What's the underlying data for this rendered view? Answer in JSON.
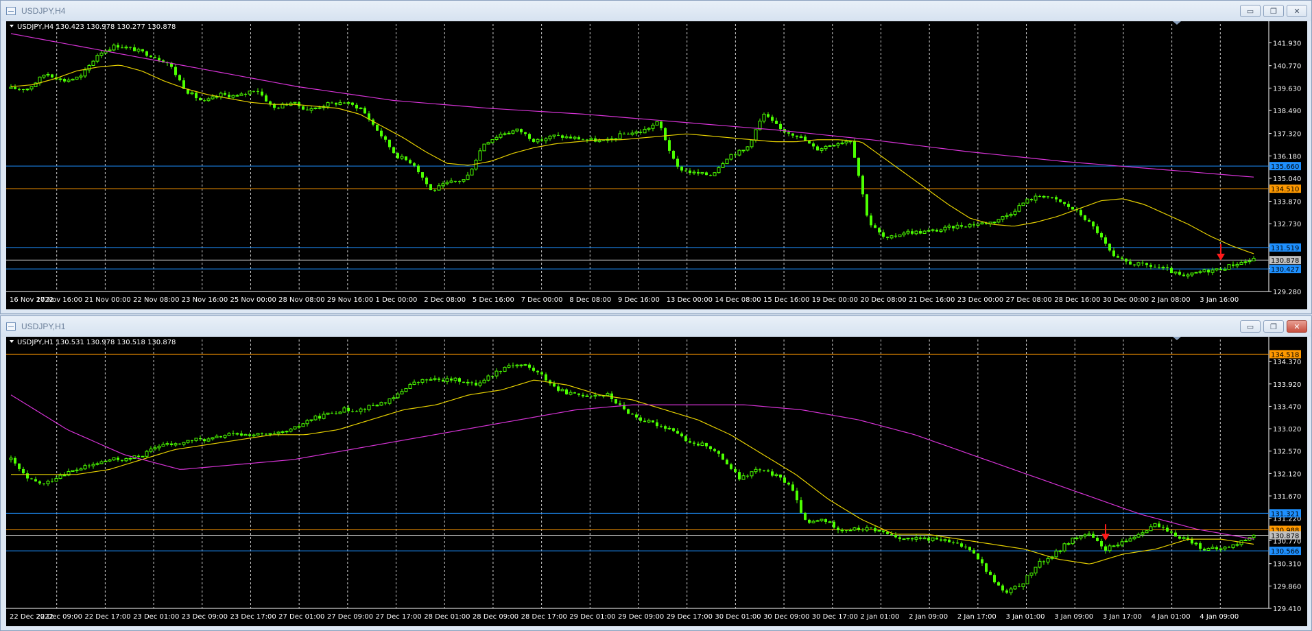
{
  "windows": [
    {
      "title": "USDJPY,H4",
      "info": "USDJPY,H4  130.423 130.978 130.277 130.878",
      "controls": {
        "minimize": "▭",
        "maximize": "❐",
        "close": "✕"
      },
      "chart_data": {
        "type": "candlestick",
        "symbol": "USDJPY",
        "timeframe": "H4",
        "ohlc_last": {
          "open": 130.423,
          "high": 130.978,
          "low": 130.277,
          "close": 130.878
        },
        "ylim": [
          129.28,
          142.4
        ],
        "y_ticks": [
          141.93,
          140.77,
          139.63,
          138.49,
          137.32,
          136.18,
          135.04,
          133.87,
          132.73,
          131.59,
          130.45,
          129.28
        ],
        "y_tick_labels": [
          "141.930",
          "140.770",
          "139.630",
          "138.490",
          "137.320",
          "136.180",
          "135.040",
          "133.870",
          "132.730",
          "131.590",
          "130.450",
          "129.280"
        ],
        "x_labels": [
          "16 Nov 2022",
          "17 Nov 16:00",
          "21 Nov 00:00",
          "22 Nov 08:00",
          "23 Nov 16:00",
          "25 Nov 00:00",
          "28 Nov 08:00",
          "29 Nov 16:00",
          "1 Dec 00:00",
          "2 Dec 08:00",
          "5 Dec 16:00",
          "7 Dec 00:00",
          "8 Dec 08:00",
          "9 Dec 16:00",
          "13 Dec 00:00",
          "14 Dec 08:00",
          "15 Dec 16:00",
          "19 Dec 00:00",
          "20 Dec 08:00",
          "21 Dec 16:00",
          "23 Dec 00:00",
          "27 Dec 08:00",
          "28 Dec 16:00",
          "30 Dec 00:00",
          "2 Jan 08:00",
          "3 Jan 16:00"
        ],
        "grid": true,
        "hlines": [
          {
            "price": 135.66,
            "label": "135.660",
            "color": "#1e90ff"
          },
          {
            "price": 134.51,
            "label": "134.510",
            "color": "#ff9900"
          },
          {
            "price": 131.519,
            "label": "131.519",
            "color": "#1e90ff"
          },
          {
            "price": 130.878,
            "label": "130.878",
            "color": "#c0c0c0"
          },
          {
            "price": 130.427,
            "label": "130.427",
            "color": "#1e90ff"
          }
        ],
        "ma_fast_color": "#e6d000",
        "ma_slow_color": "#d633d6",
        "candle_color": "#4cff00",
        "arrow_color": "#ff1a1a",
        "close_path": [
          139.6,
          139.6,
          140.4,
          140.0,
          140.2,
          141.4,
          141.8,
          141.6,
          141.3,
          140.9,
          139.5,
          138.9,
          139.3,
          139.2,
          139.6,
          138.6,
          138.9,
          138.5,
          138.8,
          138.9,
          138.6,
          137.4,
          136.2,
          135.8,
          134.4,
          134.8,
          135.0,
          136.8,
          137.3,
          137.5,
          136.9,
          137.2,
          137.1,
          137.0,
          136.9,
          137.3,
          137.4,
          137.9,
          135.6,
          135.3,
          135.2,
          136.2,
          136.5,
          138.3,
          137.5,
          137.2,
          136.5,
          136.8,
          137.0,
          132.8,
          131.9,
          132.3,
          132.3,
          132.4,
          132.6,
          132.7,
          132.8,
          133.2,
          133.9,
          134.2,
          133.8,
          133.3,
          132.4,
          131.0,
          130.7,
          130.6,
          130.4,
          130.0,
          130.3,
          130.4,
          130.7,
          130.9
        ],
        "ma_fast_path": [
          139.7,
          139.8,
          140.1,
          140.5,
          140.7,
          140.8,
          140.5,
          140.0,
          139.6,
          139.3,
          139.1,
          138.9,
          138.8,
          138.8,
          138.7,
          138.6,
          138.3,
          137.7,
          137.1,
          136.4,
          135.8,
          135.7,
          135.9,
          136.3,
          136.6,
          136.8,
          136.9,
          137.0,
          137.0,
          137.1,
          137.2,
          137.3,
          137.2,
          137.1,
          137.0,
          136.9,
          136.9,
          137.0,
          137.0,
          136.9,
          136.1,
          135.3,
          134.5,
          133.7,
          133.0,
          132.7,
          132.6,
          132.8,
          133.1,
          133.5,
          133.9,
          134.0,
          133.7,
          133.2,
          132.7,
          132.1,
          131.6,
          131.2
        ],
        "ma_slow_path": [
          142.4,
          141.5,
          140.6,
          139.7,
          139.0,
          138.6,
          138.3,
          137.9,
          137.5,
          137.0,
          136.4,
          135.9,
          135.5,
          135.1
        ],
        "arrow_index": 70
      }
    },
    {
      "title": "USDJPY,H1",
      "info": "USDJPY,H1  130.531 130.978 130.518 130.878",
      "controls": {
        "minimize": "▭",
        "maximize": "❐",
        "close": "✕"
      },
      "chart_data": {
        "type": "candlestick",
        "symbol": "USDJPY",
        "timeframe": "H1",
        "ohlc_last": {
          "open": 130.531,
          "high": 130.978,
          "low": 130.518,
          "close": 130.878
        },
        "ylim": [
          129.41,
          134.62
        ],
        "y_ticks": [
          134.37,
          133.92,
          133.47,
          133.02,
          132.57,
          132.12,
          131.67,
          131.22,
          130.77,
          130.31,
          129.86,
          129.41
        ],
        "y_tick_labels": [
          "134.370",
          "133.920",
          "133.470",
          "133.020",
          "132.570",
          "132.120",
          "131.670",
          "131.220",
          "130.770",
          "130.310",
          "129.860",
          "129.410"
        ],
        "x_labels": [
          "22 Dec 2022",
          "22 Dec 09:00",
          "22 Dec 17:00",
          "23 Dec 01:00",
          "23 Dec 09:00",
          "23 Dec 17:00",
          "27 Dec 01:00",
          "27 Dec 09:00",
          "27 Dec 17:00",
          "28 Dec 01:00",
          "28 Dec 09:00",
          "28 Dec 17:00",
          "29 Dec 01:00",
          "29 Dec 09:00",
          "29 Dec 17:00",
          "30 Dec 01:00",
          "30 Dec 09:00",
          "30 Dec 17:00",
          "2 Jan 01:00",
          "2 Jan 09:00",
          "2 Jan 17:00",
          "3 Jan 01:00",
          "3 Jan 09:00",
          "3 Jan 17:00",
          "4 Jan 01:00",
          "4 Jan 09:00"
        ],
        "grid": true,
        "hlines": [
          {
            "price": 134.518,
            "label": "134.518",
            "color": "#ff9900"
          },
          {
            "price": 131.321,
            "label": "131.321",
            "color": "#1e90ff"
          },
          {
            "price": 130.988,
            "label": "130.988",
            "color": "#ff9900"
          },
          {
            "price": 130.878,
            "label": "130.878",
            "color": "#c0c0c0"
          },
          {
            "price": 130.566,
            "label": "130.566",
            "color": "#1e90ff"
          }
        ],
        "ma_fast_color": "#e6d000",
        "ma_slow_color": "#d633d6",
        "candle_color": "#4cff00",
        "arrow_color": "#ff1a1a",
        "close_path": [
          132.4,
          132.0,
          131.9,
          132.1,
          132.2,
          132.3,
          132.4,
          132.4,
          132.5,
          132.7,
          132.7,
          132.8,
          132.8,
          132.9,
          132.9,
          132.9,
          132.9,
          133.0,
          133.2,
          133.3,
          133.4,
          133.4,
          133.5,
          133.6,
          133.9,
          134.0,
          134.0,
          134.0,
          133.9,
          134.1,
          134.3,
          134.3,
          134.1,
          133.8,
          133.7,
          133.7,
          133.7,
          133.4,
          133.2,
          133.1,
          133.0,
          132.7,
          132.7,
          132.4,
          132.0,
          132.2,
          132.1,
          131.9,
          131.1,
          131.2,
          131.0,
          131.0,
          131.0,
          130.9,
          130.8,
          130.8,
          130.8,
          130.7,
          130.6,
          130.1,
          129.7,
          129.9,
          130.3,
          130.5,
          130.8,
          130.9,
          130.6,
          130.7,
          130.9,
          131.1,
          130.9,
          130.8,
          130.6,
          130.6,
          130.7,
          130.9
        ],
        "ma_fast_path": [
          132.1,
          132.1,
          132.1,
          132.2,
          132.4,
          132.6,
          132.7,
          132.8,
          132.9,
          132.9,
          133.0,
          133.2,
          133.4,
          133.5,
          133.7,
          133.8,
          134.0,
          133.9,
          133.7,
          133.6,
          133.4,
          133.2,
          132.9,
          132.5,
          132.1,
          131.6,
          131.2,
          130.9,
          130.9,
          130.8,
          130.7,
          130.6,
          130.4,
          130.3,
          130.5,
          130.6,
          130.8,
          130.8,
          130.7
        ],
        "ma_slow_path": [
          133.7,
          133.0,
          132.5,
          132.2,
          132.3,
          132.4,
          132.6,
          132.8,
          133.0,
          133.2,
          133.4,
          133.5,
          133.5,
          133.5,
          133.4,
          133.2,
          132.9,
          132.5,
          132.1,
          131.7,
          131.3,
          131.0,
          130.8
        ],
        "arrow_index": 67
      }
    }
  ]
}
